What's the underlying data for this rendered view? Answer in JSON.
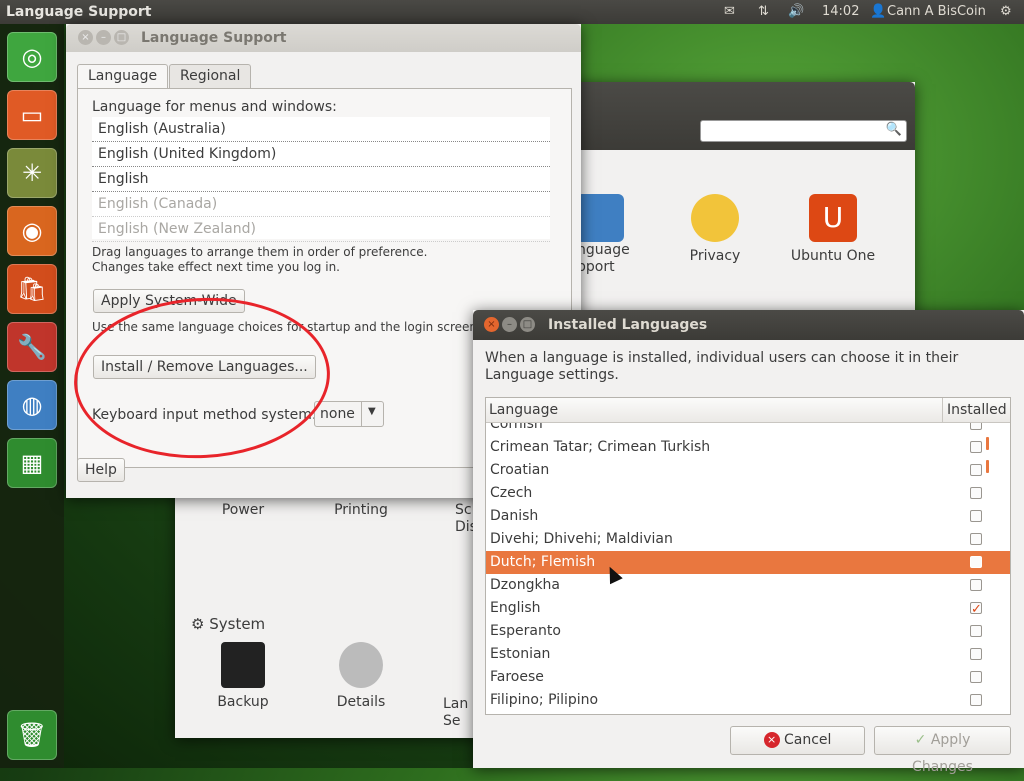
{
  "top_panel": {
    "app_title": "Language Support",
    "clock": "14:02",
    "user": "Cann A BisCoin"
  },
  "settings_window": {
    "items_row1": [
      {
        "label": "Language\nSupport",
        "partial": "nguage\npport",
        "icon": "language-support-icon"
      },
      {
        "label": "Privacy",
        "icon": "privacy-icon"
      },
      {
        "label": "Ubuntu One",
        "icon": "ubuntu-one-icon"
      }
    ],
    "items_row2": [
      {
        "label": "Power",
        "icon": "power-icon"
      },
      {
        "label": "Printing",
        "icon": "printing-icon"
      },
      {
        "label": "Sc\nDis",
        "icon": "screen-display-icon"
      }
    ],
    "section_system": "System",
    "items_row3": [
      {
        "label": "Backup",
        "icon": "backup-icon"
      },
      {
        "label": "Details",
        "icon": "details-icon"
      },
      {
        "label": "Lan\nSe",
        "icon": "language-support-icon"
      }
    ]
  },
  "language_support": {
    "title": "Language Support",
    "tabs": [
      "Language",
      "Regional Formats"
    ],
    "menus_label": "Language for menus and windows:",
    "languages": [
      {
        "name": "English (Australia)",
        "dim": false
      },
      {
        "name": "English (United Kingdom)",
        "dim": false
      },
      {
        "name": "English",
        "dim": false
      },
      {
        "name": "English (Canada)",
        "dim": true
      },
      {
        "name": "English (New Zealand)",
        "dim": true
      }
    ],
    "hint_line1": "Drag languages to arrange them in order of preference.",
    "hint_line2": "Changes take effect next time you log in.",
    "apply_system_wide": "Apply System-Wide",
    "apply_hint": "Use the same language choices for startup and the login screen.",
    "install_remove": "Install / Remove Languages...",
    "keyboard_label": "Keyboard input method system:",
    "keyboard_value": "none",
    "help": "Help"
  },
  "installed_languages": {
    "title": "Installed Languages",
    "description": "When a language is installed, individual users can choose it in their Language settings.",
    "col_language": "Language",
    "col_installed": "Installed",
    "rows": [
      {
        "name": "Cornish",
        "installed": false
      },
      {
        "name": "Crimean Tatar; Crimean Turkish",
        "installed": false
      },
      {
        "name": "Croatian",
        "installed": false
      },
      {
        "name": "Czech",
        "installed": false
      },
      {
        "name": "Danish",
        "installed": false
      },
      {
        "name": "Divehi; Dhivehi; Maldivian",
        "installed": false
      },
      {
        "name": "Dutch; Flemish",
        "installed": false,
        "selected": true
      },
      {
        "name": "Dzongkha",
        "installed": false
      },
      {
        "name": "English",
        "installed": true
      },
      {
        "name": "Esperanto",
        "installed": false
      },
      {
        "name": "Estonian",
        "installed": false
      },
      {
        "name": "Faroese",
        "installed": false
      },
      {
        "name": "Filipino; Pilipino",
        "installed": false
      }
    ],
    "cancel": "Cancel",
    "apply_changes": "Apply Changes"
  },
  "colors": {
    "accent": "#e9773f",
    "title_bar": "#3c3b37",
    "annotation": "#e8242a"
  }
}
